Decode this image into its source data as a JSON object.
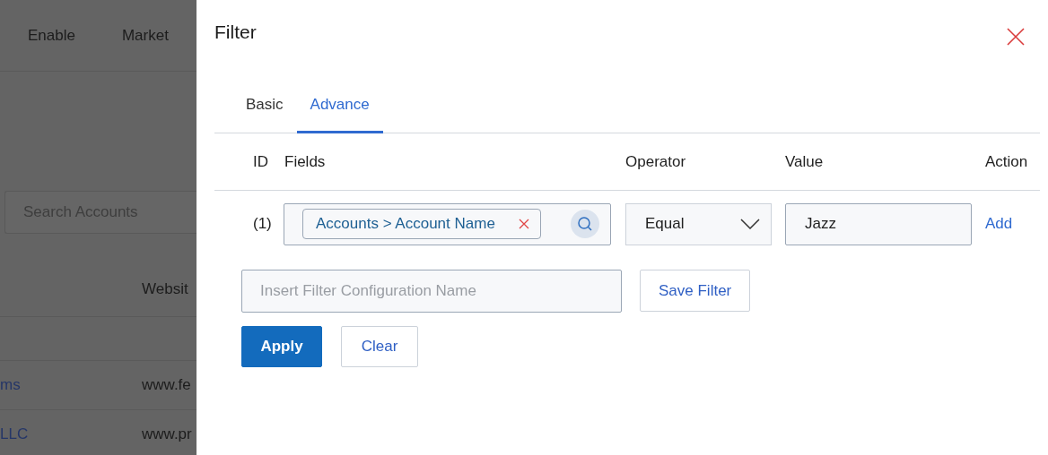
{
  "background": {
    "nav": [
      "Enable",
      "Market"
    ],
    "search": {
      "placeholder": "Search Accounts"
    },
    "table": {
      "columns": [
        "",
        "Websit"
      ],
      "rows": [
        [
          "ms",
          "www.fe"
        ],
        [
          "LLC",
          "www.pr"
        ]
      ]
    }
  },
  "drawer": {
    "title": "Filter",
    "tabs": [
      {
        "label": "Basic",
        "selected": false
      },
      {
        "label": "Advance",
        "selected": true
      }
    ],
    "columns": [
      "ID",
      "Fields",
      "Operator",
      "Value",
      "Action"
    ],
    "rows": [
      {
        "id": "(1)",
        "field_tag": "Accounts > Account Name",
        "operator": "Equal",
        "value": "Jazz",
        "action": "Add"
      }
    ],
    "config_name": {
      "placeholder": "Insert Filter Configuration Name"
    },
    "save_button": "Save Filter",
    "buttons": [
      {
        "label": "Apply",
        "kind": "primary"
      },
      {
        "label": "Clear",
        "kind": "secondary"
      }
    ]
  }
}
